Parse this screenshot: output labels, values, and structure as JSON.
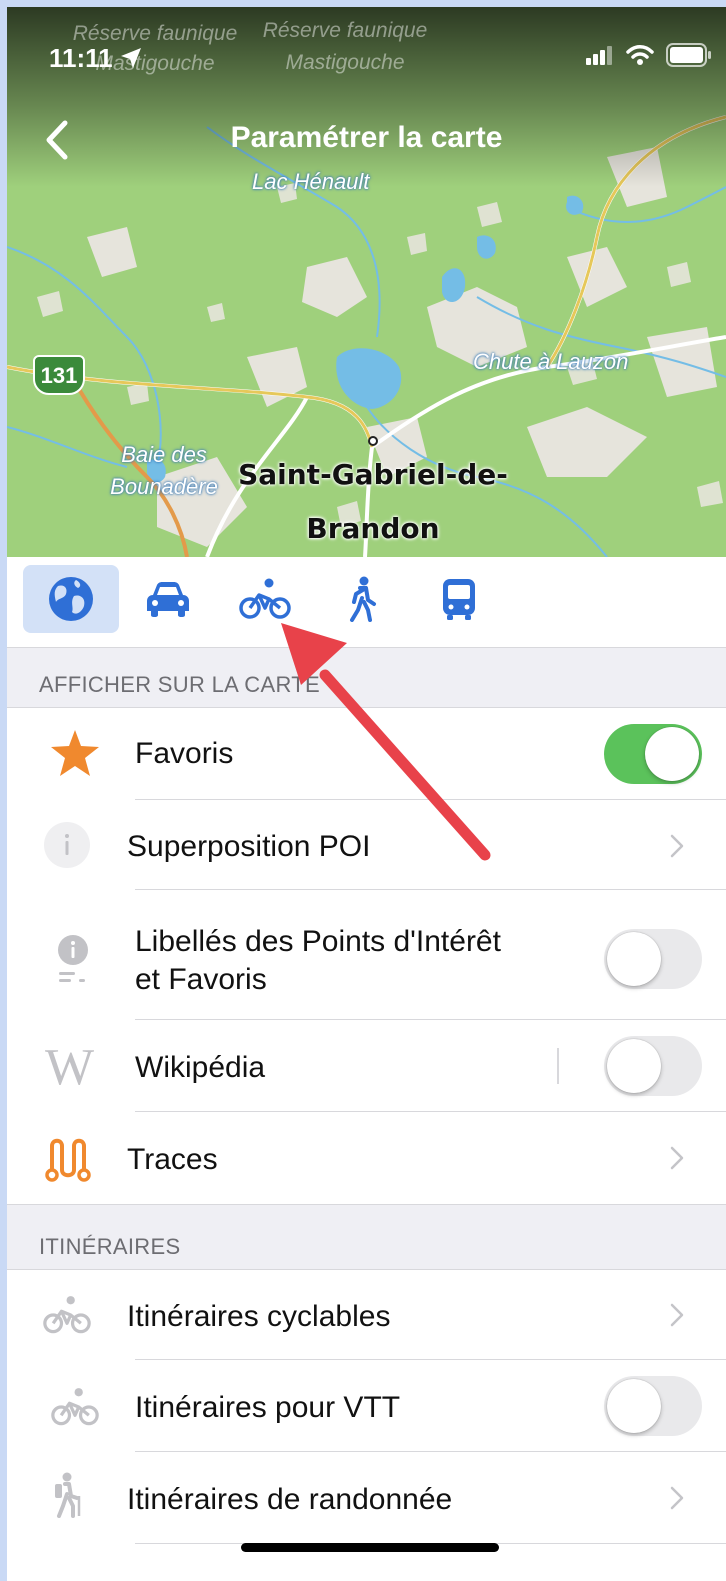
{
  "status": {
    "time": "11:11"
  },
  "nav": {
    "title": "Paramétrer la carte",
    "back_icon": "chevron-left-icon"
  },
  "map": {
    "labels": {
      "reserve1": "Réserve faunique Mastigouche",
      "reserve2": "Réserve faunique Mastigouche",
      "lake": "Lac Hénault",
      "chute": "Chute à Lauzon",
      "baie": "Baie des Bounadère",
      "city_line1": "Saint-Gabriel-de-",
      "city_line2": "Brandon",
      "route": "131"
    }
  },
  "modes": [
    {
      "name": "globe-icon",
      "active": true
    },
    {
      "name": "car-icon",
      "active": false
    },
    {
      "name": "bicycle-icon",
      "active": false
    },
    {
      "name": "pedestrian-icon",
      "active": false
    },
    {
      "name": "bus-icon",
      "active": false
    }
  ],
  "sections": {
    "show_on_map": "AFFICHER SUR LA CARTE",
    "routes": "ITINÉRAIRES"
  },
  "rows": {
    "favorites": {
      "label": "Favoris",
      "toggle": true
    },
    "poi_overlay": {
      "label": "Superposition POI"
    },
    "poi_labels": {
      "line1": "Libellés des Points d'Intérêt",
      "line2": "et Favoris",
      "toggle": false
    },
    "wikipedia": {
      "label": "Wikipédia",
      "toggle": false
    },
    "tracks": {
      "label": "Traces"
    },
    "cycle_routes": {
      "label": "Itinéraires cyclables"
    },
    "mtb_routes": {
      "label": "Itinéraires pour VTT",
      "toggle": false
    },
    "hiking_routes": {
      "label": "Itinéraires de randonnée"
    }
  },
  "colors": {
    "accent_blue": "#2f6fd6",
    "toggle_on": "#5bc25b",
    "star_orange": "#f0892e",
    "annotation_red": "#e8424a"
  }
}
